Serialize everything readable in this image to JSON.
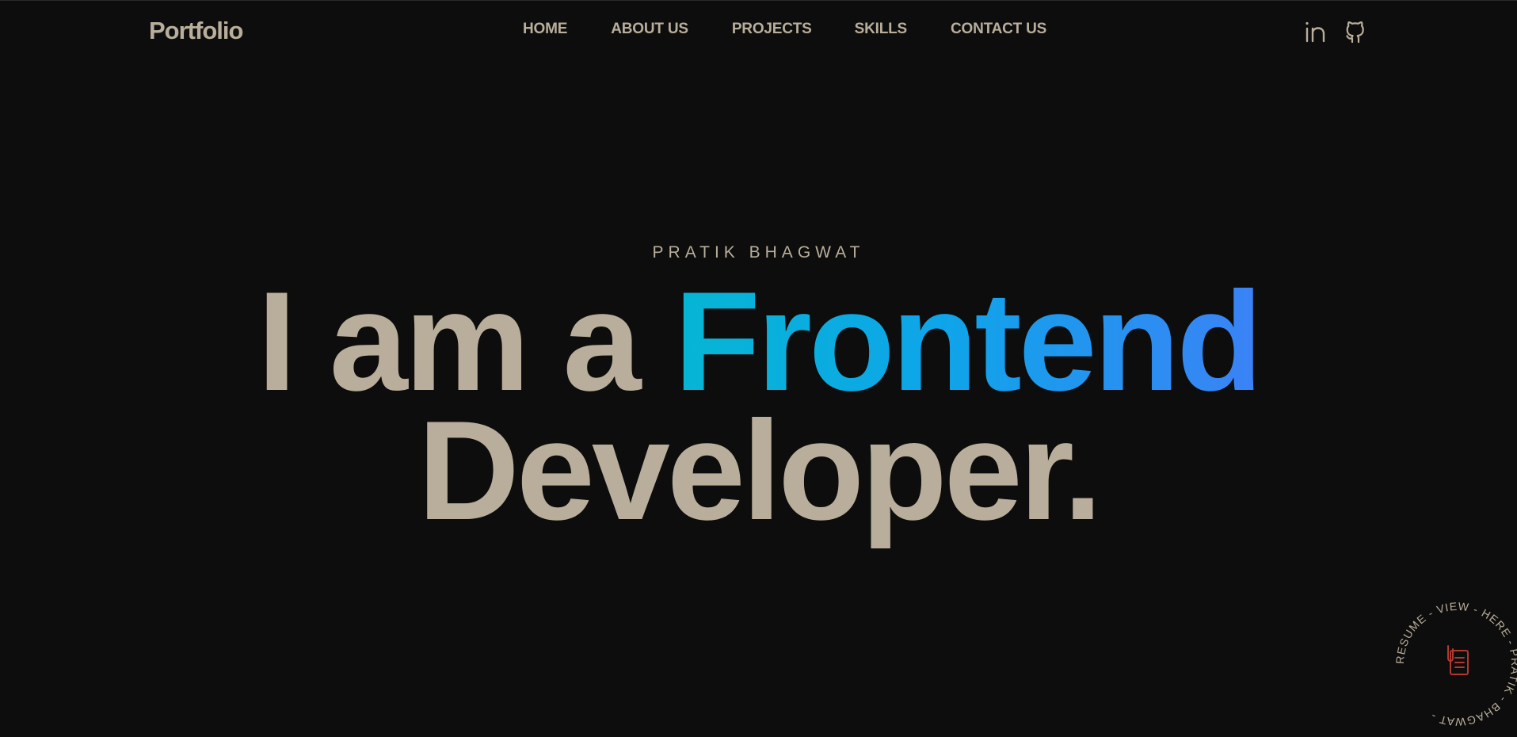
{
  "header": {
    "logo": "Portfolio",
    "nav": {
      "home": "HOME",
      "about": "ABOUT US",
      "projects": "PROJECTS",
      "skills": "SKILLS",
      "contact": "CONTACT US"
    },
    "social": [
      "linkedin-icon",
      "github-icon"
    ]
  },
  "hero": {
    "name": "PRATIK BHAGWAT",
    "line1_prefix": "I am a ",
    "line1_accent": "Frontend",
    "line2": "Developer."
  },
  "resume_badge": {
    "circle_text": "RESUME - VIEW - HERE - PRATIK - BHAGWAT - ",
    "icon": "document-icon"
  },
  "colors": {
    "background": "#0d0d0d",
    "text": "#b9ae9b",
    "accent_start": "#06b6d4",
    "accent_end": "#3b82f6",
    "icon_red": "#b0392f"
  }
}
